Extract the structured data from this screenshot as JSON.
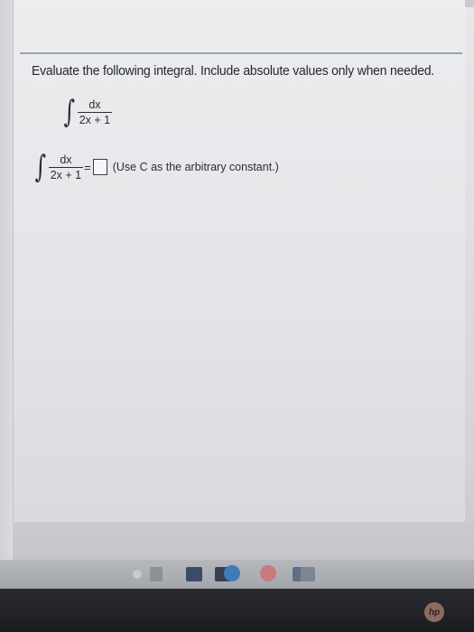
{
  "question": {
    "prompt": "Evaluate the following integral. Include absolute values only when needed."
  },
  "integral": {
    "symbol": "∫",
    "numerator": "dx",
    "denominator": "2x + 1"
  },
  "answer": {
    "equals": "=",
    "value": "",
    "hint": "(Use C as the arbitrary constant.)"
  },
  "taskbar": {
    "icons": [
      "back-icon",
      "task-view-icon",
      "store-icon",
      "mail-icon",
      "edge-icon",
      "chrome-icon",
      "windows-icon",
      "photos-icon"
    ]
  },
  "bezel": {
    "logo": "hp"
  }
}
